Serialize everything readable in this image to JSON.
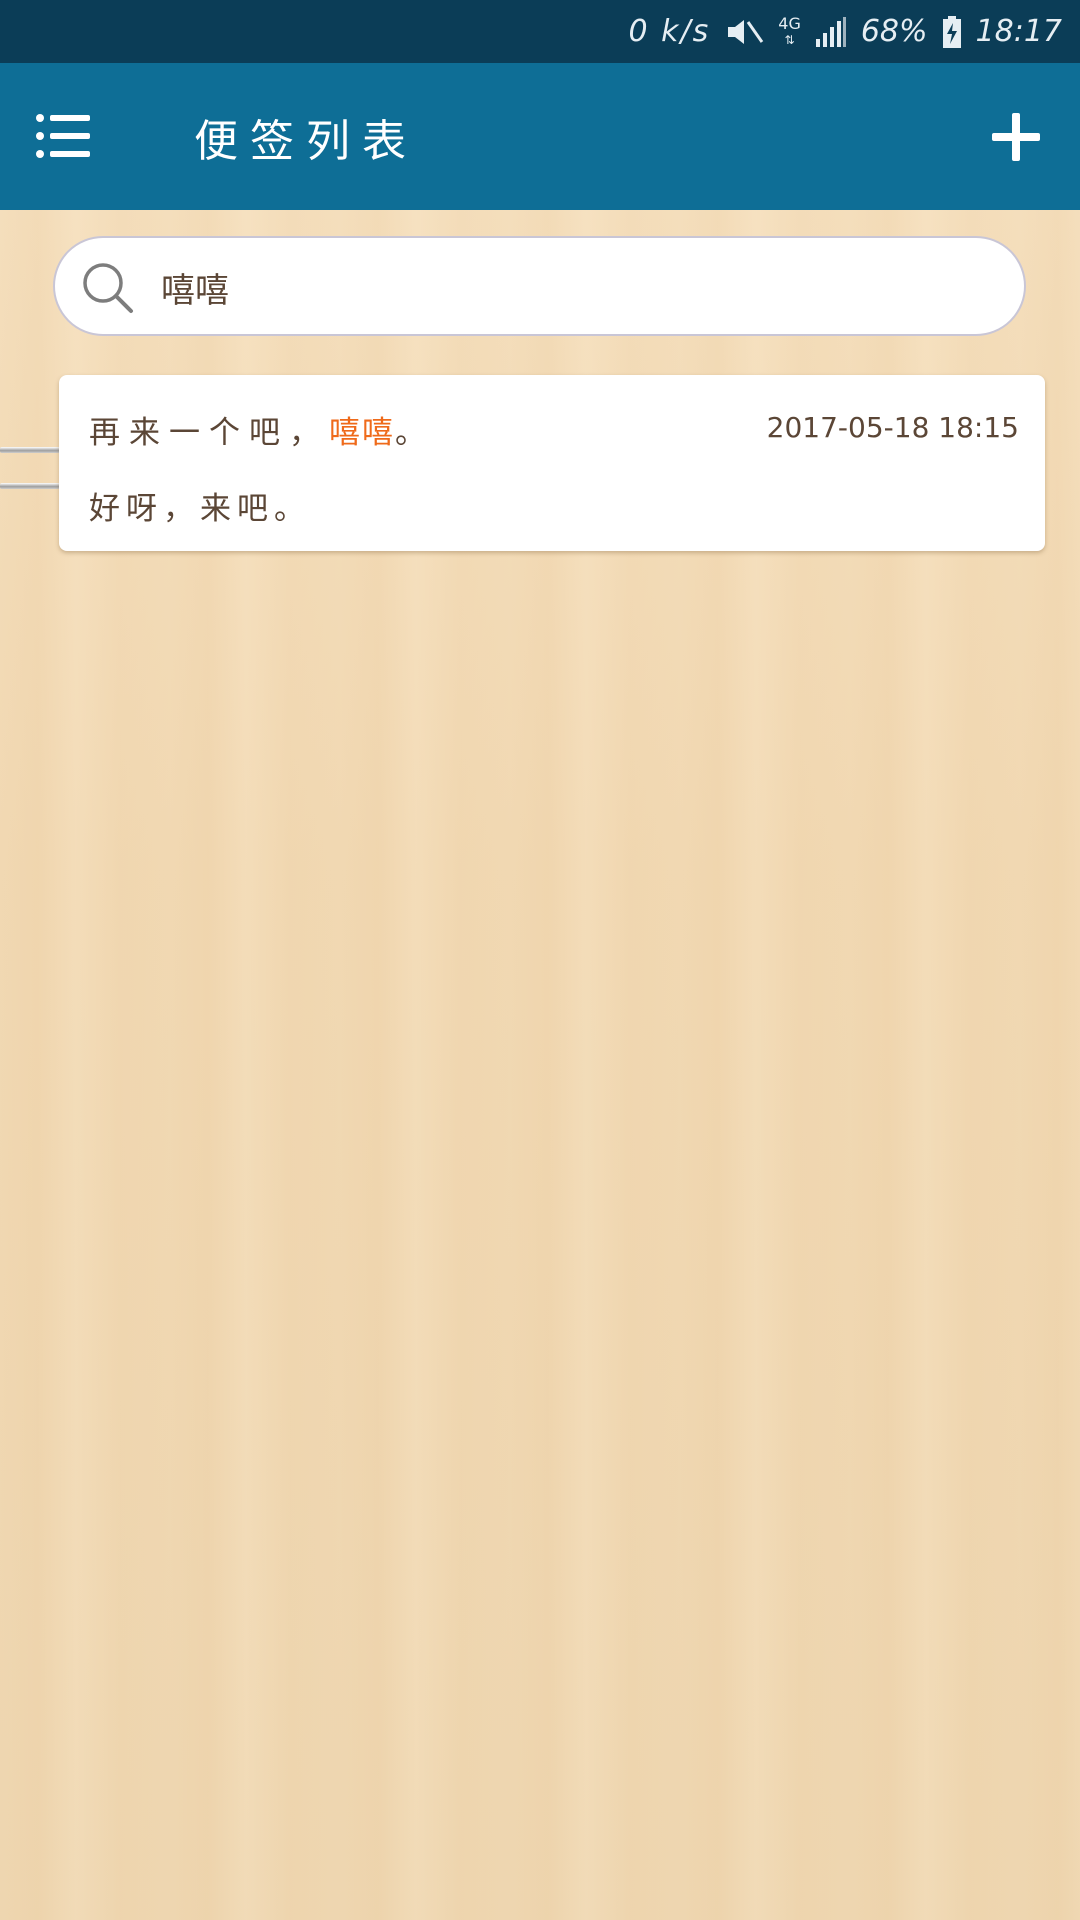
{
  "status_bar": {
    "net_speed": "0 k/s",
    "network_type": "4G",
    "battery_percent": "68%",
    "time": "18:17",
    "icons": [
      "mute-icon",
      "signal-icon",
      "battery-charging-icon"
    ]
  },
  "app_bar": {
    "title": "便签列表",
    "menu_icon": "list-menu-icon",
    "add_icon": "plus-icon",
    "color": "#0e6e96"
  },
  "search": {
    "icon": "search-icon",
    "value": "嘻嘻"
  },
  "notes": [
    {
      "title_before": "再来一个吧，",
      "title_highlight": "嘻嘻",
      "title_after": "。",
      "date": "2017-05-18 18:15",
      "body": "好呀，来吧。"
    }
  ],
  "colors": {
    "status_bar": "#0b3d57",
    "highlight": "#ef6a1a",
    "text": "#5b4636",
    "background": "#f3dcb8"
  }
}
